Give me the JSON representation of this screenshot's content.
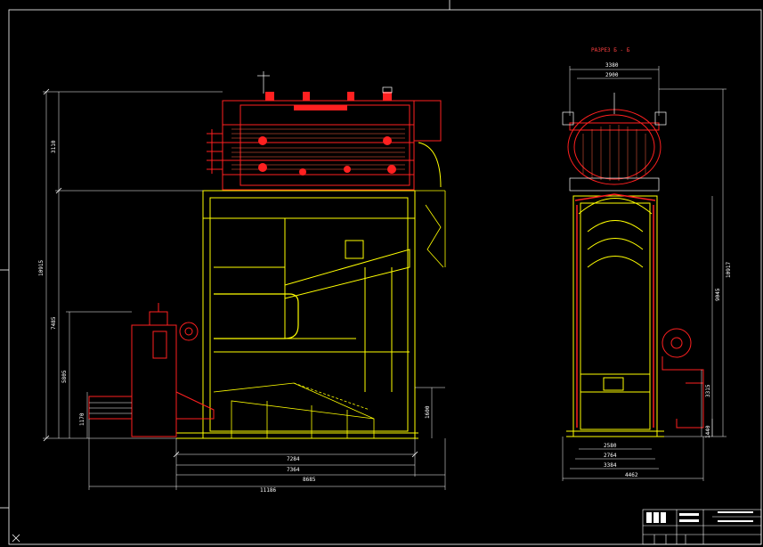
{
  "section_title": "РАЗРЕЗ Б - Б",
  "colors": {
    "background": "#000000",
    "frame": "#ffffff",
    "structure": "#ffff00",
    "equipment": "#ff0000",
    "dimension": "#ffffff"
  },
  "left_view": {
    "dim_top": "3110",
    "dim_total_height": "10915",
    "dim_mid": "7485",
    "dim_lower": "5805",
    "dim_base": "1170",
    "dim_right": "1600",
    "dim_bottom_1": "7284",
    "dim_bottom_2": "7364",
    "dim_bottom_3": "8685",
    "dim_bottom_4": "11186"
  },
  "right_view": {
    "dim_top_1": "3380",
    "dim_top_2": "2900",
    "dim_right_1": "10917",
    "dim_right_2": "9045",
    "dim_right_3": "3315",
    "dim_right_4": "1440",
    "dim_bottom_1": "2580",
    "dim_bottom_2": "2764",
    "dim_bottom_3": "3384",
    "dim_bottom_4": "4462"
  }
}
